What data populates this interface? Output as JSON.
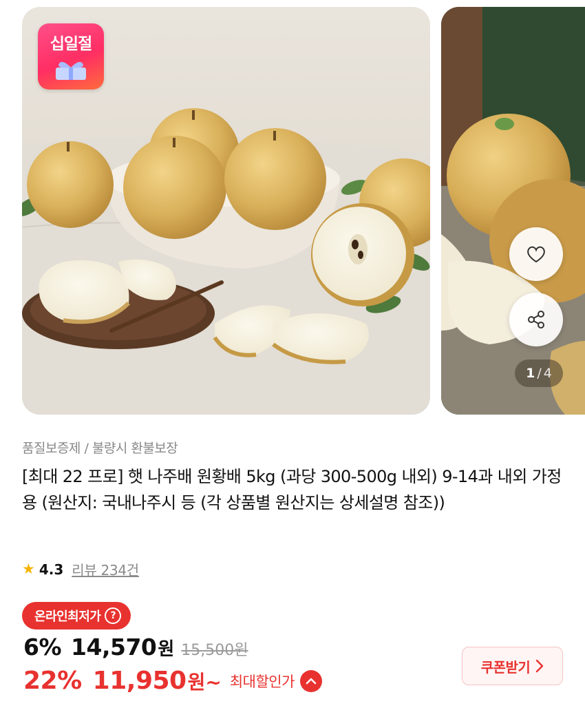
{
  "carousel": {
    "event_badge": "십일절",
    "page_current": "1",
    "page_total": "4",
    "page_separator": "/"
  },
  "product": {
    "quality_note": "품질보증제 / 불량시 환불보장",
    "title": "[최대 22 프로] 햇 나주배 원황배 5kg (과당 300-500g 내외) 9-14과 내외 가정용 (원산지: 국내나주시 등 (각 상품별 원산지는 상세설명 참조))",
    "rating": "4.3",
    "review_label": "리뷰 234건"
  },
  "price": {
    "lowest_badge": "온라인최저가",
    "discount_rate_1": "6%",
    "price_1": "14,570",
    "currency": "원",
    "original_price": "15,500원",
    "discount_rate_2": "22%",
    "price_2": "11,950",
    "currency_suffix_2": "원~",
    "max_discount_label": "최대할인가",
    "coupon_label": "쿠폰받기"
  },
  "colors": {
    "accent_red": "#e8322f",
    "star": "#f4b400",
    "muted_text": "#888888"
  },
  "icons": {
    "wishlist": "heart-icon",
    "share": "share-icon",
    "help": "question-icon",
    "expand": "chevron-up-icon",
    "coupon_arrow": "chevron-right-icon",
    "rating": "star-icon"
  }
}
